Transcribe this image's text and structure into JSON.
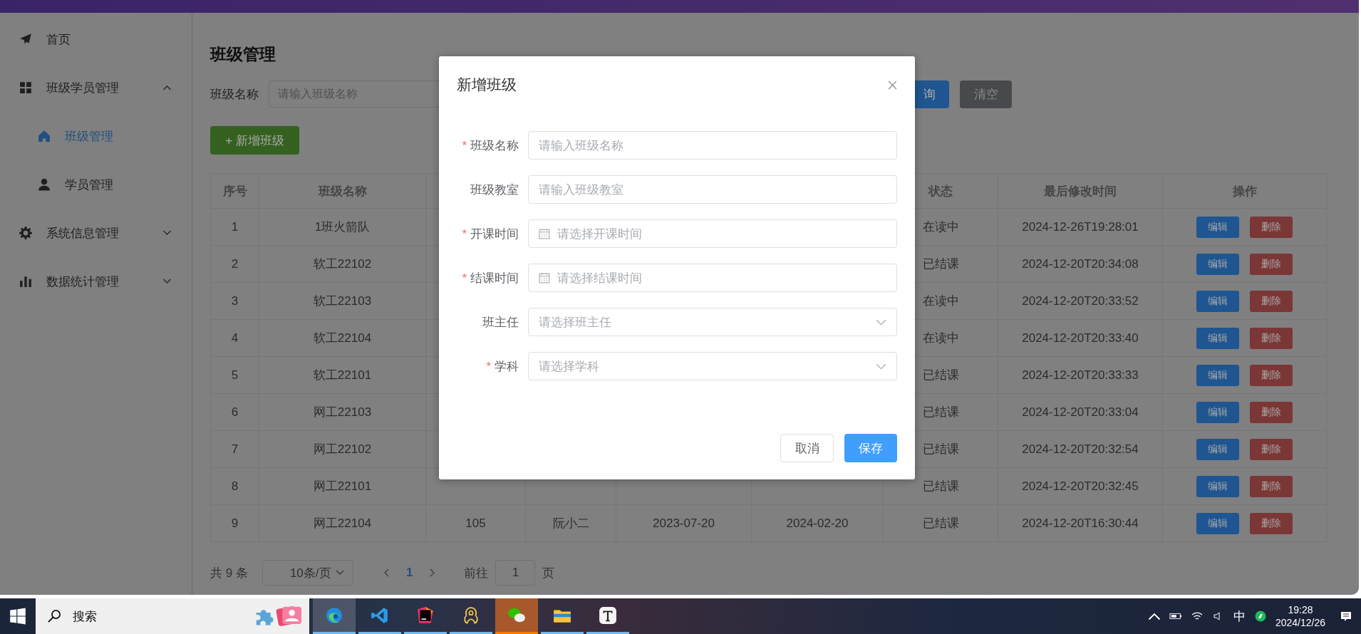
{
  "sidebar": {
    "items": [
      {
        "label": "首页",
        "selected": false
      },
      {
        "label": "班级学员管理",
        "selected": false,
        "expanded": true,
        "children": [
          {
            "label": "班级管理",
            "selected": true
          },
          {
            "label": "学员管理",
            "selected": false
          }
        ]
      },
      {
        "label": "系统信息管理",
        "selected": false,
        "expanded": false
      },
      {
        "label": "数据统计管理",
        "selected": false,
        "expanded": false
      }
    ]
  },
  "page": {
    "title": "班级管理",
    "search": {
      "label": "班级名称",
      "placeholder": "请输入班级名称",
      "buttons": [
        {
          "label": "询",
          "kind": "primary"
        },
        {
          "label": "清空",
          "kind": "info"
        }
      ]
    },
    "add_button": "+ 新增班级"
  },
  "table": {
    "columns": [
      "序号",
      "班级名称",
      "",
      "",
      "",
      "",
      "状态",
      "最后修改时间",
      "操作"
    ],
    "rows": [
      {
        "cells": [
          "1",
          "1班火箭队",
          "",
          "",
          "",
          "",
          "在读中",
          "2024-12-26T19:28:01"
        ],
        "actions": [
          {
            "label": "编辑",
            "kind": "edit"
          },
          {
            "label": "删除",
            "kind": "delete"
          }
        ]
      },
      {
        "cells": [
          "2",
          "软工22102",
          "",
          "",
          "",
          "",
          "已结课",
          "2024-12-20T20:34:08"
        ],
        "actions": [
          {
            "label": "编辑",
            "kind": "edit"
          },
          {
            "label": "删除",
            "kind": "delete"
          }
        ]
      },
      {
        "cells": [
          "3",
          "软工22103",
          "",
          "",
          "",
          "",
          "在读中",
          "2024-12-20T20:33:52"
        ],
        "actions": [
          {
            "label": "编辑",
            "kind": "edit"
          },
          {
            "label": "删除",
            "kind": "delete"
          }
        ]
      },
      {
        "cells": [
          "4",
          "软工22104",
          "",
          "",
          "",
          "",
          "在读中",
          "2024-12-20T20:33:40"
        ],
        "actions": [
          {
            "label": "编辑",
            "kind": "edit"
          },
          {
            "label": "删除",
            "kind": "delete"
          }
        ]
      },
      {
        "cells": [
          "5",
          "软工22101",
          "",
          "",
          "",
          "",
          "已结课",
          "2024-12-20T20:33:33"
        ],
        "actions": [
          {
            "label": "编辑",
            "kind": "edit"
          },
          {
            "label": "删除",
            "kind": "delete"
          }
        ]
      },
      {
        "cells": [
          "6",
          "网工22103",
          "",
          "",
          "",
          "",
          "已结课",
          "2024-12-20T20:33:04"
        ],
        "actions": [
          {
            "label": "编辑",
            "kind": "edit"
          },
          {
            "label": "删除",
            "kind": "delete"
          }
        ]
      },
      {
        "cells": [
          "7",
          "网工22102",
          "",
          "",
          "",
          "",
          "已结课",
          "2024-12-20T20:32:54"
        ],
        "actions": [
          {
            "label": "编辑",
            "kind": "edit"
          },
          {
            "label": "删除",
            "kind": "delete"
          }
        ]
      },
      {
        "cells": [
          "8",
          "网工22101",
          "",
          "",
          "",
          "",
          "已结课",
          "2024-12-20T20:32:45"
        ],
        "actions": [
          {
            "label": "编辑",
            "kind": "edit"
          },
          {
            "label": "删除",
            "kind": "delete"
          }
        ]
      },
      {
        "cells": [
          "9",
          "网工22104",
          "105",
          "阮小二",
          "2023-07-20",
          "2024-02-20",
          "已结课",
          "2024-12-20T16:30:44"
        ],
        "actions": [
          {
            "label": "编辑",
            "kind": "edit"
          },
          {
            "label": "删除",
            "kind": "delete"
          }
        ]
      }
    ]
  },
  "pagination": {
    "total": "共 9 条",
    "page_size": "10条/页",
    "pages": [
      {
        "label": "1",
        "selected": true
      }
    ],
    "goto_label": "前往",
    "goto_value": "1",
    "goto_suffix": "页"
  },
  "dialog": {
    "title": "新增班级",
    "fields": [
      {
        "label": "班级名称",
        "kind": "input",
        "mark": "*",
        "placeholder": "请输入班级名称"
      },
      {
        "label": "班级教室",
        "kind": "input",
        "placeholder": "请输入班级教室"
      },
      {
        "label": "开课时间",
        "kind": "date",
        "mark": "*",
        "placeholder": "请选择开课时间"
      },
      {
        "label": "结课时间",
        "kind": "date",
        "mark": "*",
        "placeholder": "请选择结课时间"
      },
      {
        "label": "班主任",
        "kind": "select",
        "placeholder": "请选择班主任"
      },
      {
        "label": "学科",
        "kind": "select",
        "mark": "*",
        "placeholder": "请选择学科"
      }
    ],
    "buttons": [
      {
        "label": "取消",
        "kind": "default"
      },
      {
        "label": "保存",
        "kind": "primary"
      }
    ]
  },
  "taskbar": {
    "search": {
      "placeholder": "搜索"
    },
    "apps": [
      {
        "kind": "edge",
        "selected": true,
        "attention": false
      },
      {
        "kind": "vscode",
        "selected": false,
        "attention": false
      },
      {
        "kind": "intellij",
        "selected": false,
        "attention": false
      },
      {
        "kind": "navicat",
        "selected": false,
        "attention": false
      },
      {
        "kind": "wechat",
        "selected": false,
        "attention": true
      },
      {
        "kind": "explorer",
        "selected": false,
        "attention": false
      },
      {
        "kind": "typora",
        "selected": false,
        "attention": false
      }
    ],
    "tray": {
      "ime": "中",
      "time": "19:28",
      "date": "2024/12/26"
    }
  }
}
